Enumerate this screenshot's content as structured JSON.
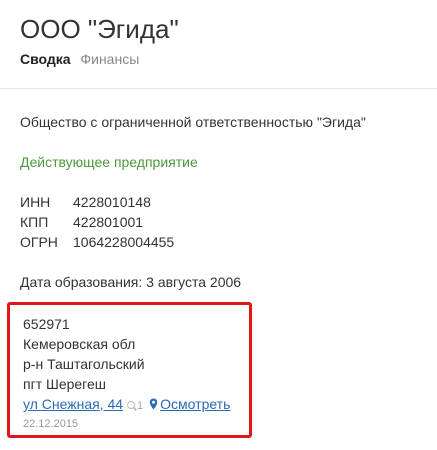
{
  "company": {
    "title": "ООО \"Эгида\""
  },
  "tabs": [
    {
      "label": "Сводка",
      "active": true
    },
    {
      "label": "Финансы",
      "active": false
    }
  ],
  "summary": {
    "full_name": "Общество с ограниченной ответственностью \"Эгида\"",
    "status": "Действующее предприятие",
    "codes": [
      {
        "label": "ИНН",
        "value": "4228010148"
      },
      {
        "label": "КПП",
        "value": "422801001"
      },
      {
        "label": "ОГРН",
        "value": "1064228004455"
      }
    ],
    "founded": "Дата образования: 3 августа 2006"
  },
  "address": {
    "postal_code": "652971",
    "region": "Кемеровская обл",
    "district": "р-н Таштагольский",
    "locality": "пгт Шерегеш",
    "street": "ул Снежная, 44",
    "search_count": "1",
    "view_label": "Осмотреть",
    "date": "22.12.2015"
  },
  "colors": {
    "status_green": "#4a9a3a",
    "link_blue": "#2a6ab8",
    "highlight_red": "#e01717"
  },
  "icons": {
    "search": "search-icon",
    "pin": "map-pin-icon"
  }
}
